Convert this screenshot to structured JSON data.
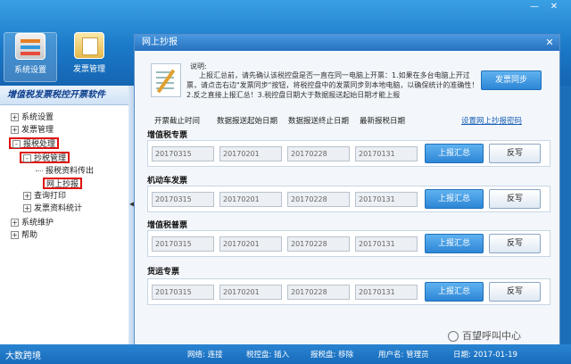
{
  "window_controls": {
    "minimize": "—",
    "close": "✕"
  },
  "toolbar": {
    "items": [
      {
        "label": "系统设置",
        "icon": "settings-icon"
      },
      {
        "label": "发票管理",
        "icon": "invoice-folder-icon"
      }
    ]
  },
  "sidebar": {
    "title": "增值税发票税控开票软件",
    "tree": [
      {
        "label": "系统设置",
        "toggle": "+"
      },
      {
        "label": "发票管理",
        "toggle": "+"
      },
      {
        "label": "报税处理",
        "toggle": "-"
      },
      {
        "label": "抄税管理",
        "toggle": "-"
      },
      {
        "label": "报税资料传出",
        "toggle": ""
      },
      {
        "label": "网上抄报",
        "toggle": ""
      },
      {
        "label": "查询打印",
        "toggle": "+"
      },
      {
        "label": "发票资料统计",
        "toggle": "+"
      },
      {
        "label": "系统维护",
        "toggle": "+"
      },
      {
        "label": "帮助",
        "toggle": "+"
      }
    ],
    "collapse_glyph": "◀"
  },
  "dialog": {
    "title": "网上抄报",
    "close_glyph": "✕",
    "note_heading": "说明:",
    "note_body": "上报汇总前，请先确认该税控盘是否一直在同一电脑上开票：1.如果在多台电脑上开过票，请点击右边\"发票同步\"按钮，将税控盘中的发票同步到本地电脑，以确保统计的准确性！2.反之直接上报汇总！3.税控盘日期大于数据报送起始日期才能上报",
    "sync_button": "发票同步",
    "columns": [
      "开票截止时间",
      "数据报送起始日期",
      "数据报送终止日期",
      "最新报税日期"
    ],
    "password_link": "设置网上抄报密码",
    "report_button": "上报汇总",
    "rewrite_button": "反写",
    "sections": [
      {
        "title": "增值税专票",
        "values": [
          "20170315",
          "20170201",
          "20170228",
          "20170131"
        ]
      },
      {
        "title": "机动车发票",
        "values": [
          "20170315",
          "20170201",
          "20170228",
          "20170131"
        ]
      },
      {
        "title": "增值税普票",
        "values": [
          "20170315",
          "20170201",
          "20170228",
          "20170131"
        ]
      },
      {
        "title": "货运专票",
        "values": [
          "20170315",
          "20170201",
          "20170228",
          "20170131"
        ]
      }
    ]
  },
  "statusbar": {
    "logo": "大数跨境",
    "network": "网络: 连接",
    "taxdisk": "税控盘: 插入",
    "reportdisk": "报税盘: 移除",
    "username": "用户名: 管理员",
    "date": "日期: 2017-01-19"
  },
  "watermark": "百望呼叫中心"
}
